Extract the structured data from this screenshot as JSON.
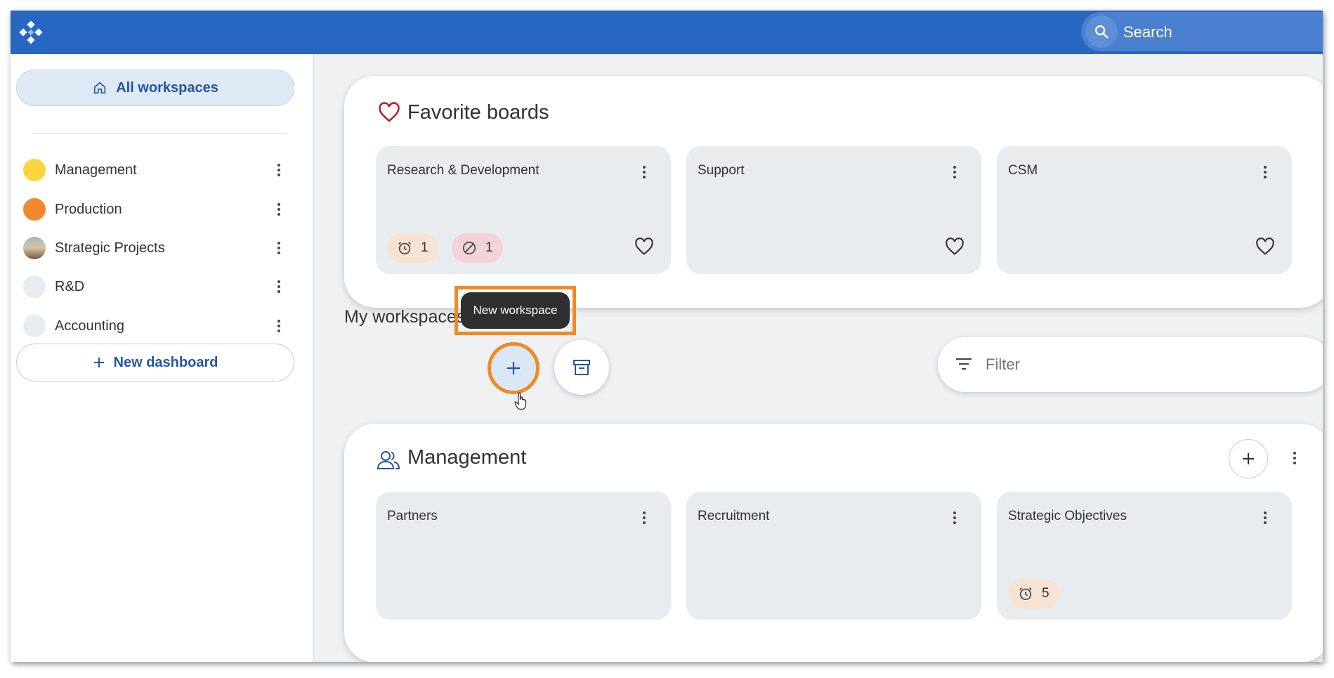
{
  "search": {
    "label": "Search"
  },
  "sidebar": {
    "all_workspaces": "All workspaces",
    "items": [
      {
        "label": "Management",
        "color": "#fbd53b"
      },
      {
        "label": "Production",
        "color": "#f08a2c"
      },
      {
        "label": "Strategic Projects",
        "color": "image"
      },
      {
        "label": "R&D",
        "color": "#e9ecef"
      },
      {
        "label": "Accounting",
        "color": "#e9ecef"
      }
    ],
    "new_dashboard": "New dashboard"
  },
  "favorites": {
    "title": "Favorite boards",
    "boards": [
      {
        "name": "Research & Development",
        "alarm_count": "1",
        "blocked_count": "1"
      },
      {
        "name": "Support"
      },
      {
        "name": "CSM"
      }
    ]
  },
  "my_workspaces": {
    "label": "My workspaces",
    "tooltip": "New workspace",
    "filter_placeholder": "Filter"
  },
  "management": {
    "title": "Management",
    "boards": [
      {
        "name": "Partners"
      },
      {
        "name": "Recruitment"
      },
      {
        "name": "Strategic Objectives",
        "alarm_count": "5"
      }
    ]
  },
  "colors": {
    "topbar": "#2767c2",
    "accent": "#2355a6",
    "highlight": "#f08a24",
    "heart_red": "#b3272f"
  }
}
